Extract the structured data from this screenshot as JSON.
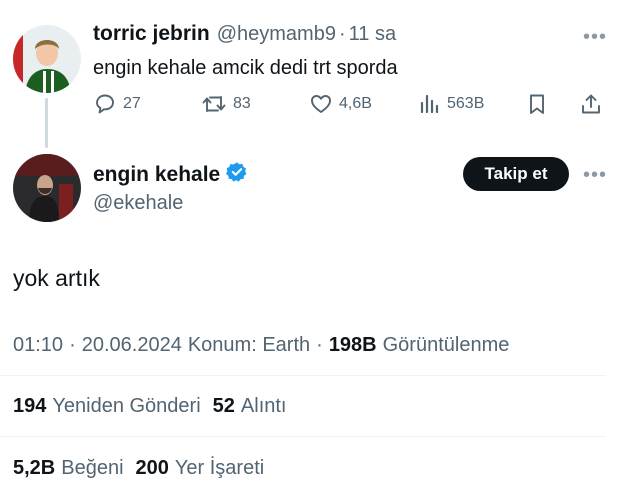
{
  "reply_tweet": {
    "display_name": "torric jebrin",
    "handle": "@heymamb9",
    "separator": "·",
    "time_ago": "11 sa",
    "text": "engin kehale amcik dedi trt sporda",
    "more_label": "•••",
    "actions": {
      "replies": "27",
      "retweets": "83",
      "likes": "4,6B",
      "views": "563B"
    }
  },
  "main_tweet": {
    "display_name": "engin kehale",
    "handle": "@ekehale",
    "follow_label": "Takip et",
    "more_label": "•••",
    "text": "yok artık",
    "time": "01:10",
    "dot1": "·",
    "date": "20.06.2024",
    "location": "Konum: Earth",
    "dot2": "·",
    "views_count": "198B",
    "views_label": "Görüntülenme",
    "stats": {
      "reposts_count": "194",
      "reposts_label": "Yeniden Gönderi",
      "quotes_count": "52",
      "quotes_label": "Alıntı",
      "likes_count": "5,2B",
      "likes_label": "Beğeni",
      "bookmarks_count": "200",
      "bookmarks_label": "Yer İşareti"
    }
  },
  "colors": {
    "verified": "#1d9bf0",
    "text": "#0f1419",
    "muted": "#536471",
    "divider": "#eff3f4"
  }
}
